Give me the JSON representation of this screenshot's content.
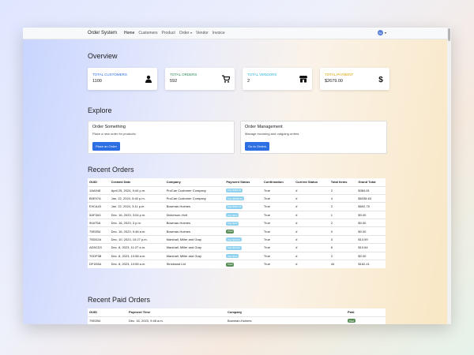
{
  "nav": {
    "brand": "Order System",
    "links": [
      "Home",
      "Customers",
      "Product",
      "Order",
      "Vendor",
      "Invoice"
    ],
    "user_initials": "Pe"
  },
  "overview": {
    "title": "Overview",
    "cards": [
      {
        "label": "TOTAL CUSTOMERS",
        "value": "1100",
        "icon": "user-icon",
        "color": "#2d6fe3"
      },
      {
        "label": "TOTAL ORDERS",
        "value": "592",
        "icon": "cart-icon",
        "color": "#2e8b57"
      },
      {
        "label": "TOTAL VENDORS",
        "value": "2",
        "icon": "store-icon",
        "color": "#2ab3d9"
      },
      {
        "label": "TOTAL PAYMENT",
        "value": "$2679.00",
        "icon": "dollar-icon",
        "color": "#d9a400"
      }
    ]
  },
  "explore": {
    "title": "Explore",
    "cards": [
      {
        "title": "Order Something",
        "text": "Place a new order for products.",
        "button": "Place an Order"
      },
      {
        "title": "Order Management",
        "text": "Manage incoming and outgoing orders.",
        "button": "Go to Orders"
      }
    ]
  },
  "recent_orders": {
    "title": "Recent Orders",
    "columns": [
      "GUID",
      "Created Date",
      "Company",
      "Payment Status",
      "Confirmation",
      "Current Status",
      "Total Items",
      "Grand Total"
    ],
    "rows": [
      {
        "guid": "1AA948",
        "date": "April 25, 2024, 9:44 p.m.",
        "company": "ProCan Customer Company",
        "payment": "Pay $384.81",
        "badge": "blue",
        "confirmation": "True",
        "status": "#",
        "items": "2",
        "total": "$384.81"
      },
      {
        "guid": "B0E97A",
        "date": "Jan. 22, 2024, 5:40 p.m.",
        "company": "ProCan Customer Company",
        "payment": "Pay $6338.63",
        "badge": "blue",
        "confirmation": "True",
        "status": "#",
        "items": "4",
        "total": "$6338.63"
      },
      {
        "guid": "E9CA43",
        "date": "Jan. 22, 2024, 3:11 p.m.",
        "company": "Bowman-Holmes",
        "payment": "Pay $692.75",
        "badge": "blue",
        "confirmation": "True",
        "status": "#",
        "items": "2",
        "total": "$692.75"
      },
      {
        "guid": "5AF3A3",
        "date": "Dec. 16, 2023, 3:04 p.m.",
        "company": "Dickerson-Holt",
        "payment": "Pay $0.0",
        "badge": "blue",
        "confirmation": "True",
        "status": "#",
        "items": "1",
        "total": "$0.00"
      },
      {
        "guid": "90A75A",
        "date": "Dec. 16, 2023, 3 p.m.",
        "company": "Bowman-Holmes",
        "payment": "Pay $0.0",
        "badge": "blue",
        "confirmation": "True",
        "status": "#",
        "items": "2",
        "total": "$0.00"
      },
      {
        "guid": "79E2B4",
        "date": "Dec. 16, 2023, 9:46 a.m.",
        "company": "Bowman-Holmes",
        "payment": "Paid",
        "badge": "green",
        "confirmation": "True",
        "status": "#",
        "items": "0",
        "total": "$0.00"
      },
      {
        "guid": "75DD2A",
        "date": "Dec. 10, 2023, 10:27 p.m.",
        "company": "Marshall, Miller and Gray",
        "payment": "Pay $13.59",
        "badge": "blue",
        "confirmation": "True",
        "status": "#",
        "items": "3",
        "total": "$13.59"
      },
      {
        "guid": "AD5CD3",
        "date": "Dec. 8, 2023, 11:27 a.m.",
        "company": "Marshall, Miller and Gray",
        "payment": "Pay $10.64",
        "badge": "blue",
        "confirmation": "True",
        "status": "#",
        "items": "6",
        "total": "$10.64"
      },
      {
        "guid": "7DDF5B",
        "date": "Dec. 8, 2023, 10:58 a.m.",
        "company": "Marshall, Miller and Gray",
        "payment": "Pay $0.0",
        "badge": "blue",
        "confirmation": "True",
        "status": "#",
        "items": "2",
        "total": "$0.00"
      },
      {
        "guid": "DF1E8A",
        "date": "Dec. 8, 2023, 10:55 a.m.",
        "company": "Strickland Ltd",
        "payment": "Paid",
        "badge": "green",
        "confirmation": "True",
        "status": "#",
        "items": "44",
        "total": "$162.41"
      }
    ]
  },
  "recent_paid": {
    "title": "Recent Paid Orders",
    "columns": [
      "GUID",
      "Payment Time",
      "Company",
      "Paid"
    ],
    "rows": [
      {
        "guid": "79E2B4",
        "time": "Dec. 16, 2023, 9:46 a.m.",
        "company": "Bowman-Holmes",
        "paid": "Paid"
      }
    ]
  }
}
